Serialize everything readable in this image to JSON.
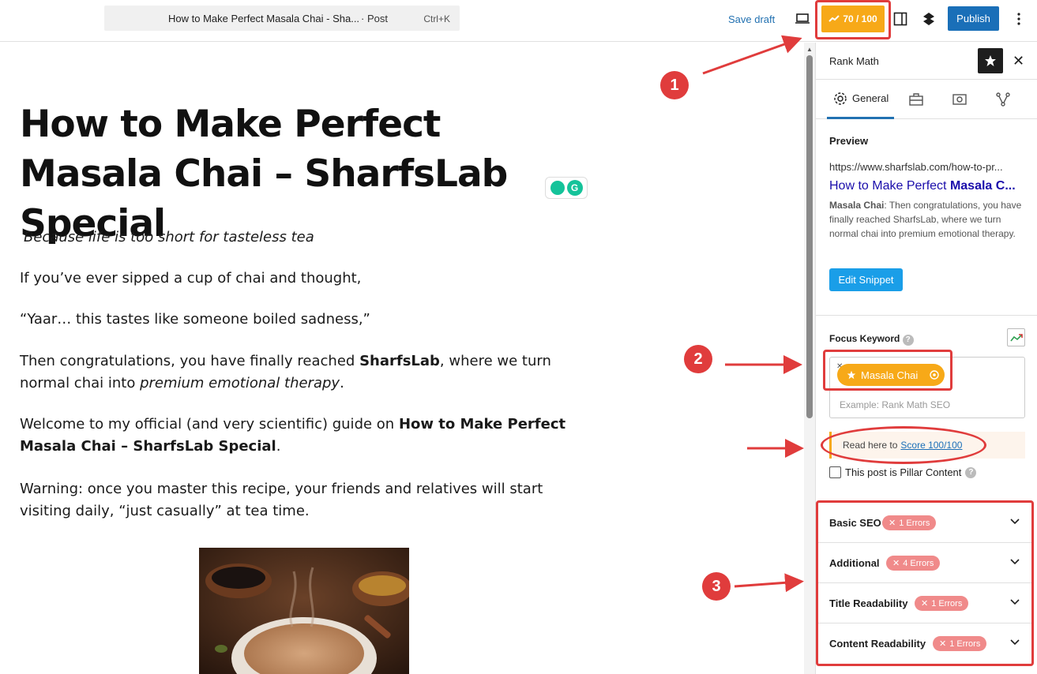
{
  "topbar": {
    "command_title": "How to Make Perfect Masala Chai - Sha...",
    "command_type": "· Post",
    "command_shortcut": "Ctrl+K",
    "save_draft": "Save draft",
    "score": "70 / 100",
    "publish": "Publish"
  },
  "post": {
    "title": "How to Make Perfect Masala Chai – SharfsLab Special",
    "tagline": "Because life is too short for tasteless tea",
    "p1": "If you’ve ever sipped a cup of chai and thought,",
    "p2": "“Yaar… this tastes like someone boiled sadness,”",
    "p3_a": "Then congratulations, you have finally reached ",
    "p3_b": "SharfsLab",
    "p3_c": ", where we turn normal chai into ",
    "p3_d": "premium emotional therapy",
    "p3_e": ".",
    "p4_a": "Welcome to my official (and very scientific) guide on ",
    "p4_b": "How to Make Perfect Masala Chai – SharfsLab Special",
    "p4_c": ".",
    "p5": "Warning: once you master this recipe, your friends and relatives will start visiting daily, “just casually” at tea time."
  },
  "sidebar": {
    "title": "Rank Math",
    "tab_general": "General",
    "preview_label": "Preview",
    "preview_url": "https://www.sharfslab.com/how-to-pr...",
    "preview_title_a": "How to Make Perfect ",
    "preview_title_b": "Masala C...",
    "preview_desc_a": "Masala Chai",
    "preview_desc_b": ": Then congratulations, you have finally reached SharfsLab, where we turn normal chai into premium emotional therapy.",
    "edit_snippet": "Edit Snippet",
    "focus_keyword_label": "Focus Keyword",
    "keyword": "Masala Chai",
    "keyword_placeholder": "Example: Rank Math SEO",
    "read_here": "Read here to",
    "score_link": "Score 100/100",
    "pillar_label": "This post is Pillar Content",
    "panels": [
      {
        "label": "Basic SEO",
        "badge": "1 Errors"
      },
      {
        "label": "Additional",
        "badge": "4 Errors"
      },
      {
        "label": "Title Readability",
        "badge": "1 Errors"
      },
      {
        "label": "Content Readability",
        "badge": "1 Errors"
      }
    ]
  },
  "annotations": {
    "n1": "1",
    "n2": "2",
    "n3": "3"
  },
  "colors": {
    "accent": "#2271b1",
    "score": "#f7a918",
    "annotation": "#e03c3c",
    "error_badge": "#f08a8a"
  }
}
